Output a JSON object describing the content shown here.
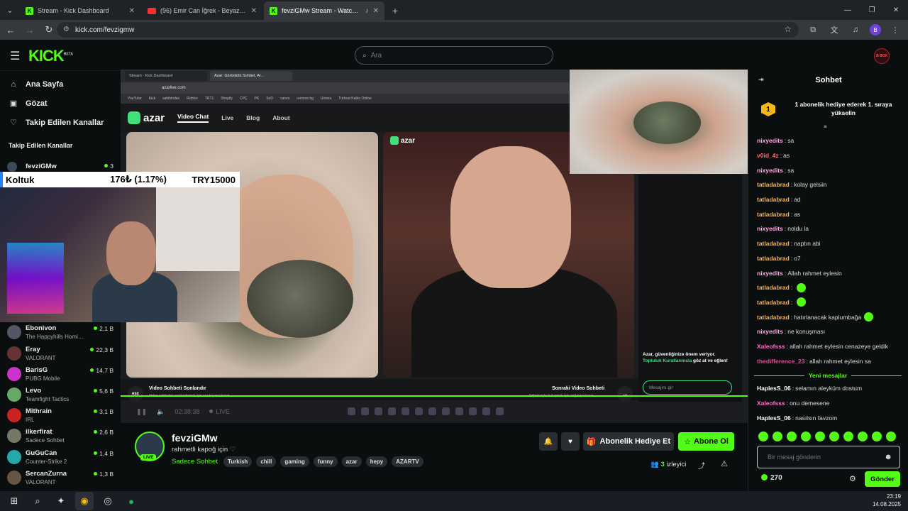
{
  "browser": {
    "tabs": [
      {
        "label": "Stream - Kick Dashboard",
        "icon": "kick"
      },
      {
        "label": "(96) Emir Can İğrek - Beyaz Sk…",
        "icon": "youtube"
      },
      {
        "label": "fevziGMw Stream - Watch l…",
        "icon": "kick"
      }
    ],
    "url": "kick.com/fevzigmw"
  },
  "header": {
    "logo": "KICK",
    "logo_sup": "BETA",
    "search_placeholder": "Ara",
    "avatar_text": "B BOX"
  },
  "sidebar": {
    "nav": [
      {
        "label": "Ana Sayfa",
        "icon": "home-icon"
      },
      {
        "label": "Gözat",
        "icon": "browse-icon"
      },
      {
        "label": "Takip Edilen Kanallar",
        "icon": "heart-icon"
      }
    ],
    "section_title": "Takip Edilen Kanallar",
    "top_channel": {
      "name": "fevziGMw",
      "viewers": "3"
    },
    "channels": [
      {
        "name": "Ebonivon",
        "category": "The Happyhills Homi…",
        "viewers": "2,1 B"
      },
      {
        "name": "Eray",
        "category": "VALORANT",
        "viewers": "22,3 B"
      },
      {
        "name": "BarisG",
        "category": "PUBG Mobile",
        "viewers": "14,7 B"
      },
      {
        "name": "Levo",
        "category": "Teamfight Tactics",
        "viewers": "5,6 B"
      },
      {
        "name": "Mithrain",
        "category": "IRL",
        "viewers": "3,1 B"
      },
      {
        "name": "ilkerfirat",
        "category": "Sadece Sohbet",
        "viewers": "2,6 B"
      },
      {
        "name": "GuGuCan",
        "category": "Counter-Strike 2",
        "viewers": "1,4 B"
      },
      {
        "name": "SercanZurna",
        "category": "VALORANT",
        "viewers": "1,3 B"
      }
    ]
  },
  "ticker": {
    "name": "Koltuk",
    "price": "176₺ (1.17%)",
    "target": "TRY15000"
  },
  "stream": {
    "inner_tabs": [
      "Stream - Kick Dashboard",
      "Azar: Görüntülü Sohbet, Ar…"
    ],
    "inner_url": "azarlive.com",
    "bookmarks": [
      "YouTube",
      "Kick",
      "sahibinden",
      "Roblox",
      "TRT1",
      "Shopify",
      "CPÇ",
      "PK",
      "SoD",
      "canva",
      "remove.bg",
      "Unisex",
      "Türksat Kablo Online"
    ],
    "azar_logo": "azar",
    "azar_nav": [
      "Video Chat",
      "Live",
      "Blog",
      "About"
    ],
    "notice_1": "Azar, güvenliğinize önem veriyor.",
    "notice_link": "Topluluk Kurallarımıza",
    "notice_2": "göz at ve eğlen!",
    "message_placeholder": "Mesajını gir",
    "esc": "esc",
    "end_title": "Video Sohbeti Sonlandır",
    "end_sub": "Video sohbetini sonlandırmak için esc tuşuna basın.",
    "next_title": "Sonraki Video Sohbeti",
    "next_sub": "Diğerleriyle buluşmak için sağ tuşa basın",
    "time": "02:38:38",
    "live": "LIVE"
  },
  "channel_info": {
    "name": "fevziGMw",
    "title": "rahmetli  kapoğ için",
    "category": "Sadece Sohbet",
    "live": "LIVE",
    "tags": [
      "Turkish",
      "chill",
      "gaming",
      "funny",
      "azar",
      "hepy",
      "AZARTV"
    ],
    "gift_label": "Abonelik Hediye Et",
    "subscribe_label": "Abone Ol",
    "viewers_count": "3",
    "viewers_label": "izleyici"
  },
  "chat": {
    "title": "Sohbet",
    "pinned": "1 abonelik hediye ederek 1. sıraya yükselin",
    "pinned_rank": "1",
    "messages": [
      {
        "user": "nixyedits",
        "color": "#ffa8e6",
        "text": "sa"
      },
      {
        "user": "v0id_4z",
        "color": "#ff6b6b",
        "text": "as"
      },
      {
        "user": "nixyedits",
        "color": "#ffa8e6",
        "text": "sa"
      },
      {
        "user": "tatladabrad",
        "color": "#f0b36a",
        "text": "kolay gelsiin"
      },
      {
        "user": "tatladabrad",
        "color": "#f0b36a",
        "text": "ad"
      },
      {
        "user": "tatladabrad",
        "color": "#f0b36a",
        "text": "as"
      },
      {
        "user": "nixyedits",
        "color": "#ffa8e6",
        "text": "noldu la"
      },
      {
        "user": "tatladabrad",
        "color": "#f0b36a",
        "text": "naptın abi"
      },
      {
        "user": "tatladabrad",
        "color": "#f0b36a",
        "text": "o7"
      },
      {
        "user": "nixyedits",
        "color": "#ffa8e6",
        "text": "Allah rahmet eylesin"
      },
      {
        "user": "tatladabrad",
        "color": "#f0b36a",
        "text": ""
      },
      {
        "user": "tatladabrad",
        "color": "#f0b36a",
        "text": ""
      },
      {
        "user": "tatladabrad",
        "color": "#f0b36a",
        "text": "hatırlanacak kaplumbağa"
      },
      {
        "user": "nixyedits",
        "color": "#ffa8e6",
        "text": "ne konuşması"
      },
      {
        "user": "Xaleofsss",
        "color": "#ff6fc8",
        "text": "allah rahmet eylesin cenazeye geldik"
      },
      {
        "user": "thedifference_23",
        "color": "#e34a9a",
        "text": "allah rahmet eylesin sa"
      }
    ],
    "divider": "Yeni mesajlar",
    "new_messages": [
      {
        "user": "HaplesS_06",
        "color": "#ffffff",
        "text": "selamın aleyküm dostum"
      },
      {
        "user": "Xaleofsss",
        "color": "#ff6fc8",
        "text": "onu demesene"
      },
      {
        "user": "HaplesS_06",
        "color": "#ffffff",
        "text": "nasılsın favzom"
      }
    ],
    "input_placeholder": "Bir mesaj gönderin",
    "points": "270",
    "send_label": "Gönder"
  },
  "taskbar": {
    "time": "23:19",
    "date": "14.08.2025"
  },
  "colors": {
    "accent": "#53fc18",
    "bg": "#0b0e0f"
  }
}
